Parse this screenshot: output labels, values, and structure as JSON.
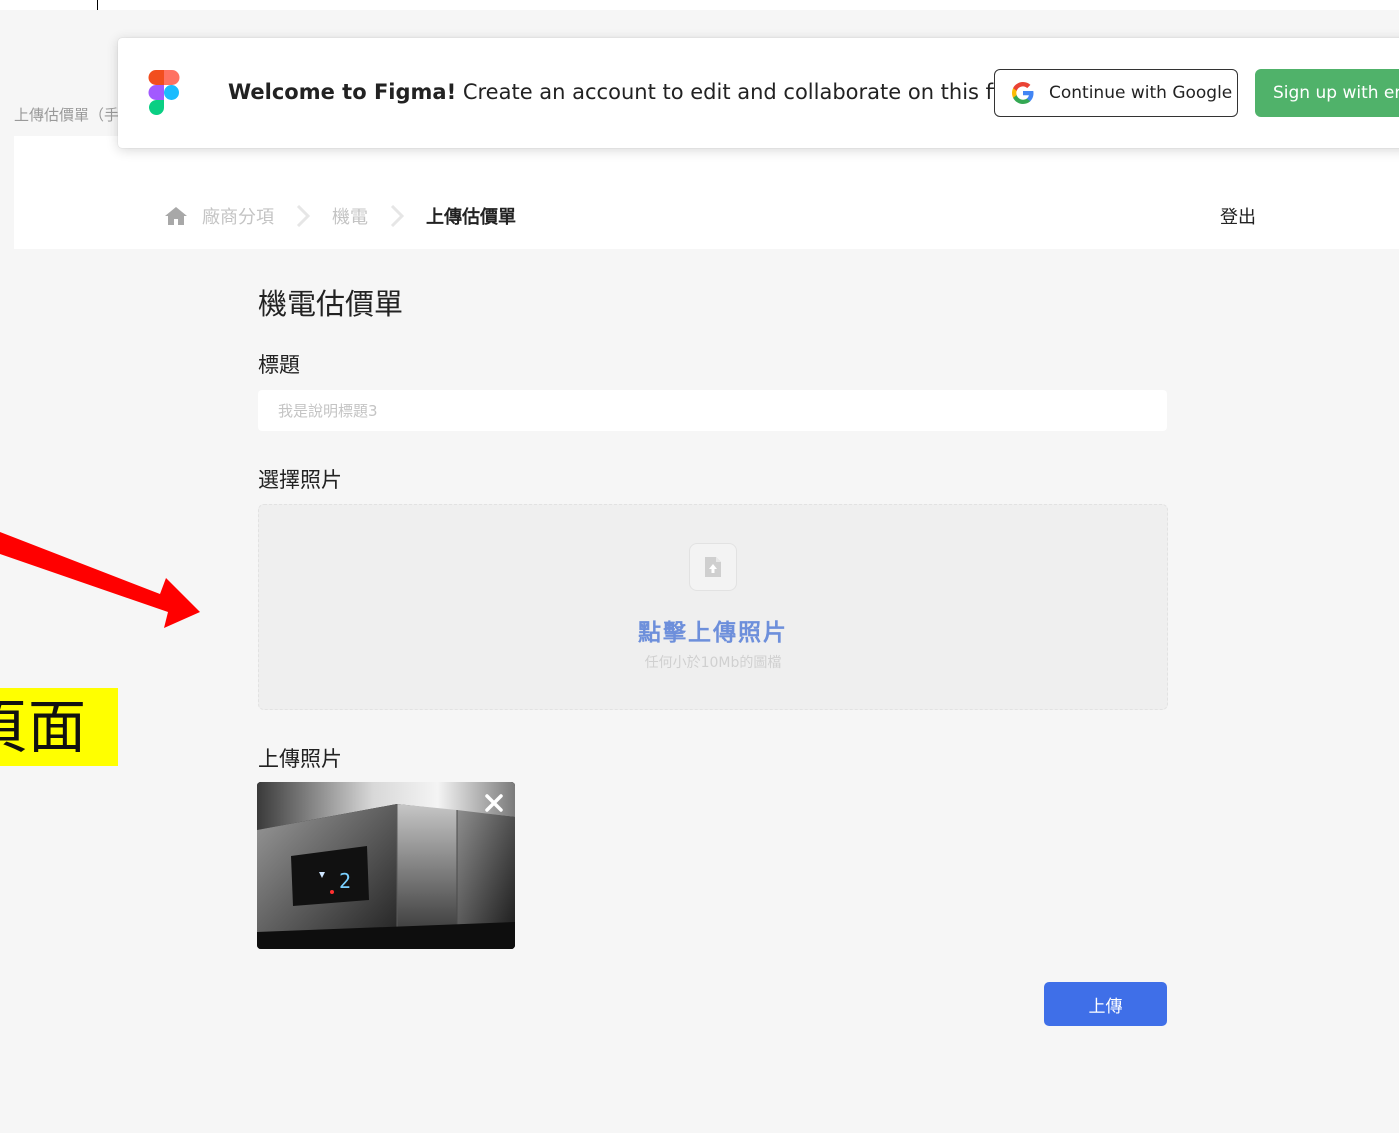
{
  "frame_label": "上傳估價單（手",
  "figma_banner": {
    "welcome_bold": "Welcome to Figma!",
    "welcome_text": " Create an account to edit and collaborate on this file.",
    "google_button": "Continue with Google",
    "signup_button": "Sign up with em",
    "google_colors": [
      "#4285F4",
      "#EA4335",
      "#FBBC05",
      "#34A853"
    ],
    "figma_colors": [
      "#F24E1E",
      "#FF7262",
      "#A259FF",
      "#1ABCFE",
      "#0ACF83"
    ]
  },
  "breadcrumb": {
    "items": [
      "廠商分項",
      "機電"
    ],
    "current": "上傳估價單"
  },
  "header": {
    "logout": "登出"
  },
  "main": {
    "page_title": "機電估價單",
    "title_label": "標題",
    "title_placeholder": "我是說明標題3",
    "choose_photo_label": "選擇照片",
    "upload_zone": {
      "title": "點擊上傳照片",
      "subtitle": "任何小於10Mb的圖檔"
    },
    "uploaded_label": "上傳照片",
    "uploaded_photo": {
      "display_text": "2"
    },
    "upload_button": "上傳",
    "accent_color": "#3f6fe8"
  },
  "annotation": {
    "note_text": "頁面",
    "arrow_color": "#ff0000",
    "note_bg": "#ffff00"
  }
}
